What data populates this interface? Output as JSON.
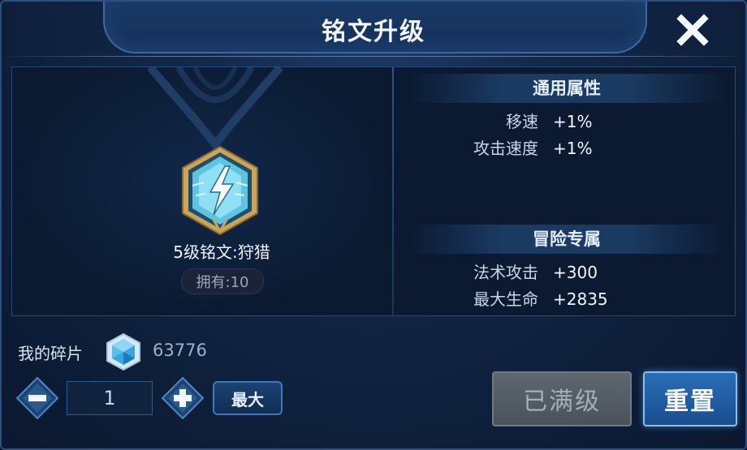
{
  "dialog": {
    "title": "铭文升级",
    "close_icon": "close-icon"
  },
  "inscription": {
    "icon": "lightning-inscription-icon",
    "name": "5级铭文:狩猎",
    "owned": "拥有:10"
  },
  "stats": {
    "general": {
      "title": "通用属性",
      "rows": [
        {
          "label": "移速",
          "value": "+1%"
        },
        {
          "label": "攻击速度",
          "value": "+1%"
        }
      ]
    },
    "adventure": {
      "title": "冒险专属",
      "rows": [
        {
          "label": "法术攻击",
          "value": "+300"
        },
        {
          "label": "最大生命",
          "value": "+2835"
        }
      ]
    }
  },
  "shards": {
    "label": "我的碎片",
    "icon": "crystal-icon",
    "count": "63776"
  },
  "quantity": {
    "value": "1",
    "max_label": "最大"
  },
  "buttons": {
    "maxed_label": "已满级",
    "reset_label": "重置"
  },
  "colors": {
    "accent": "#7fc1f3",
    "background": "#13284a",
    "disabled": "#5e6770"
  }
}
